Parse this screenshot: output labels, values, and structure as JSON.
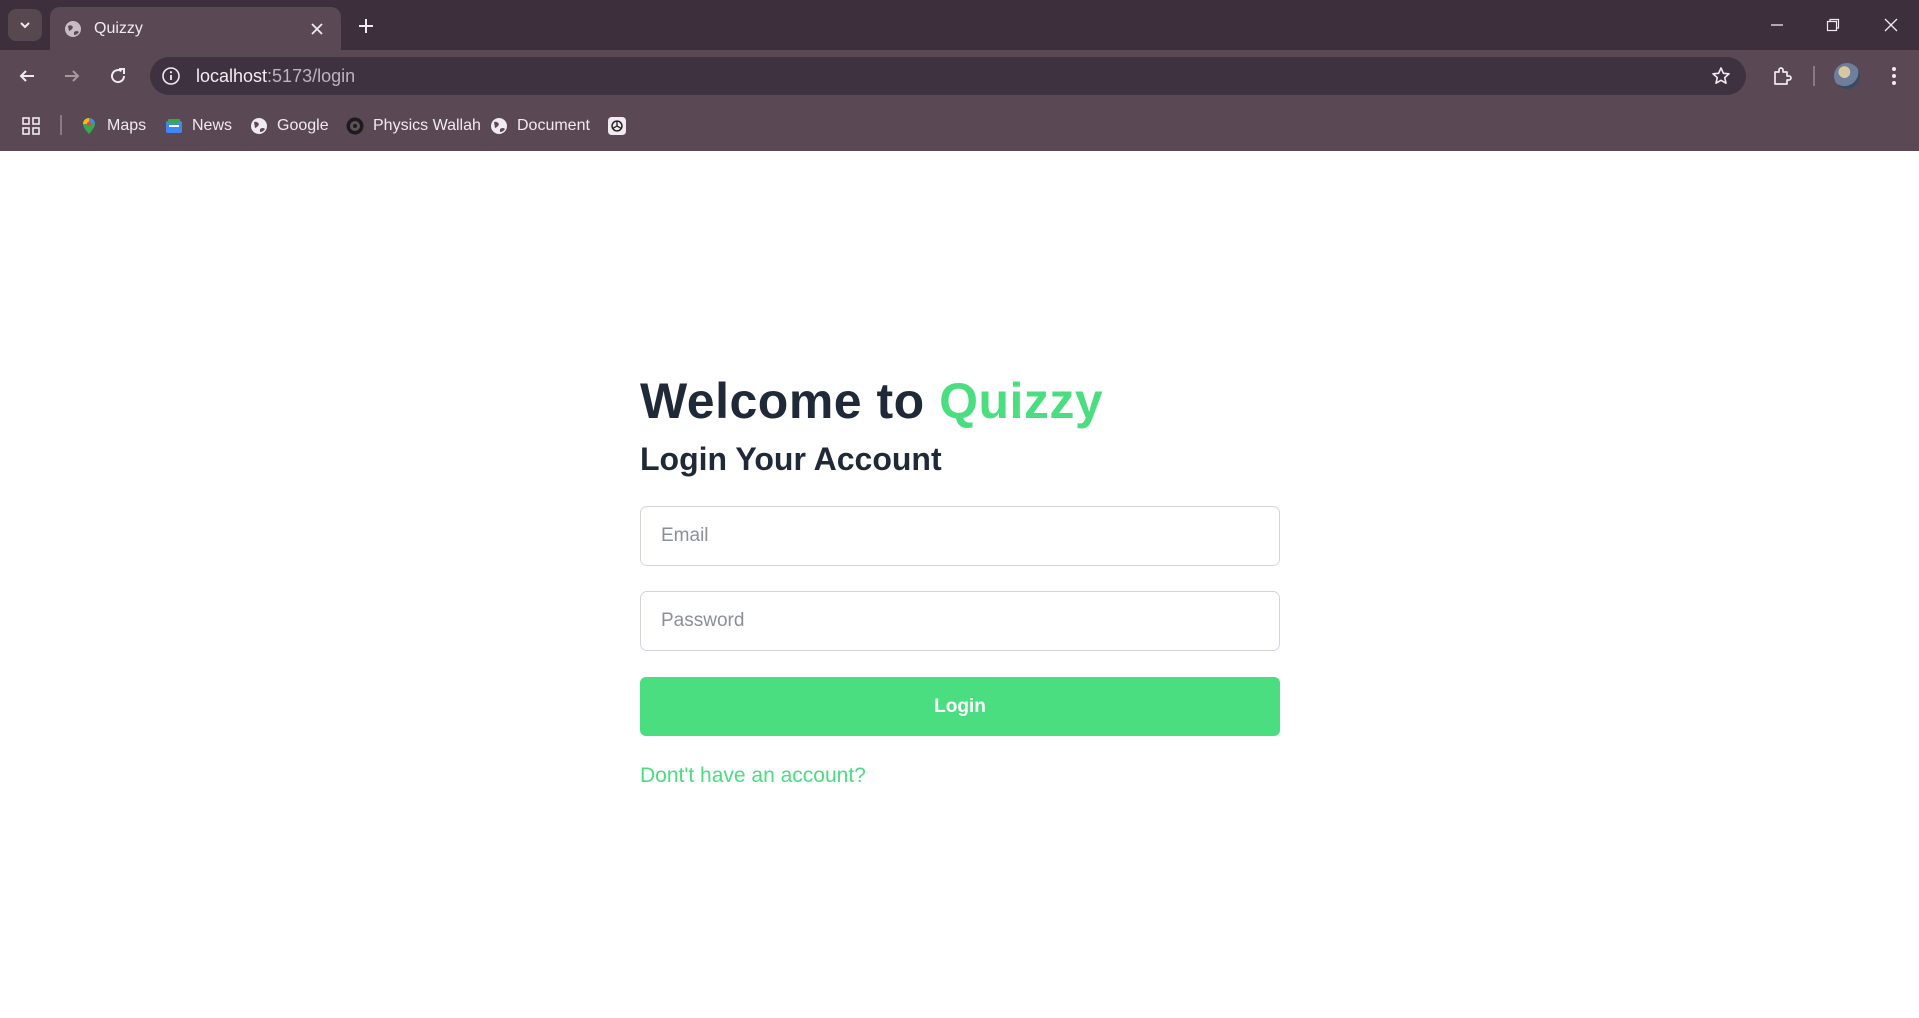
{
  "browser": {
    "tab": {
      "title": "Quizzy",
      "favicon": "globe-icon"
    },
    "address": {
      "host": "localhost",
      "path": ":5173/login"
    },
    "bookmarks": [
      {
        "label": "Maps",
        "icon": "maps-icon"
      },
      {
        "label": "News",
        "icon": "news-icon"
      },
      {
        "label": "Google",
        "icon": "globe-icon"
      },
      {
        "label": "Physics Wallah",
        "icon": "pw-icon"
      },
      {
        "label": "Document",
        "icon": "globe-icon"
      },
      {
        "label": "",
        "icon": "openai-icon"
      }
    ]
  },
  "page": {
    "welcome_prefix": "Welcome to",
    "brand": "Quizzy",
    "subtitle": "Login Your Account",
    "email_placeholder": "Email",
    "password_placeholder": "Password",
    "login_label": "Login",
    "signup_link": "Dont't have an account?"
  },
  "colors": {
    "accent": "#4ade80",
    "heading": "#1f2937",
    "chrome_dark": "#3d2f3b",
    "chrome": "#5a4954"
  }
}
